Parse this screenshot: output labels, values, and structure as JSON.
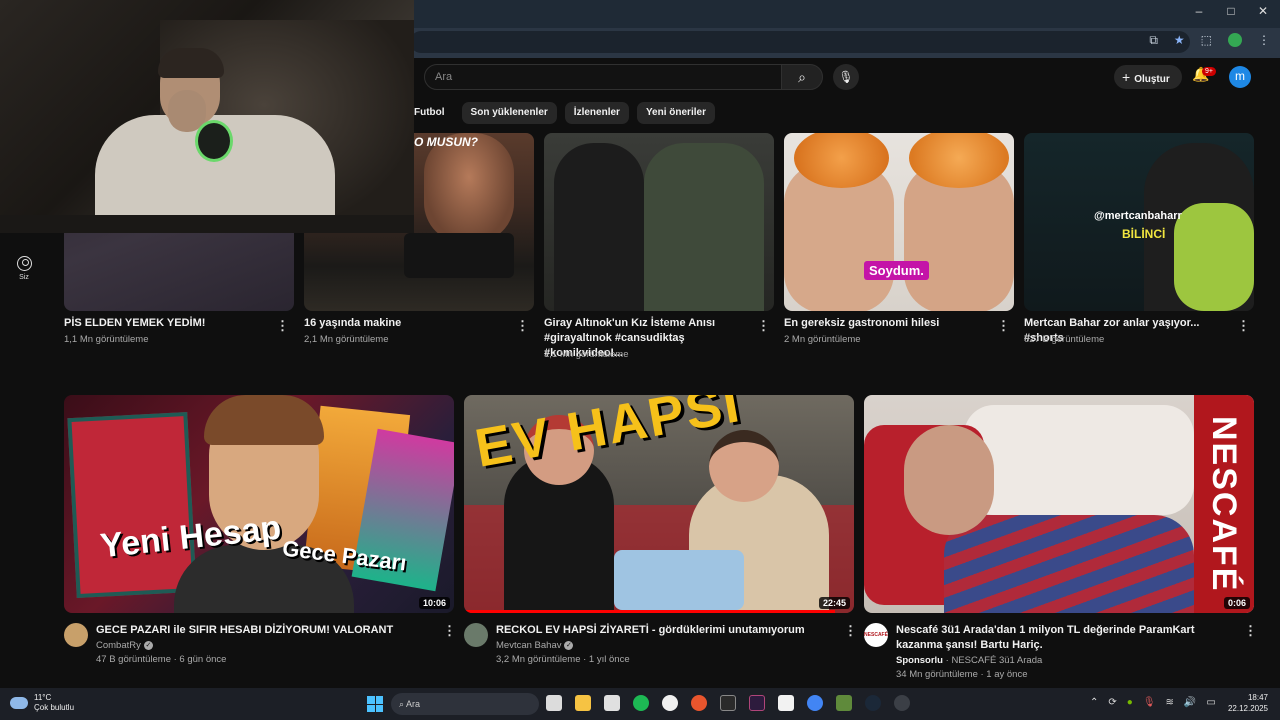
{
  "browser": {
    "window_controls": {
      "minimize": "–",
      "maximize": "□",
      "close": "✕"
    },
    "toolbar_icons": [
      "install-icon",
      "star-icon",
      "extensions-icon",
      "profile-icon",
      "menu-icon"
    ]
  },
  "header": {
    "search_placeholder": "Ara",
    "create_label": "Oluştur",
    "notification_badge": "9+",
    "avatar_letter": "m"
  },
  "chips": [
    "Futbol",
    "Son yüklenenler",
    "İzlenenler",
    "Yeni öneriler"
  ],
  "sidebar": {
    "you_label": "Siz"
  },
  "top_row": [
    {
      "title": "PİS ELDEN YEMEK YEDİM!",
      "views": "1,1 Mn görüntüleme"
    },
    {
      "title": "16 yaşında makine",
      "views": "2,1 Mn görüntüleme",
      "thumb_text": "O MUSUN?"
    },
    {
      "title": "Giray Altınok'un Kız İsteme Anısı #girayaltınok #cansudiktaş #komikvideoI...",
      "views": "1,1 Mn görüntüleme"
    },
    {
      "title": "En gereksiz gastronomi hilesi",
      "views": "2 Mn görüntüleme",
      "thumb_text": "Soydum."
    },
    {
      "title": "Mertcan Bahar zor anlar yaşıyor... #shorts",
      "views": "627 B görüntüleme",
      "thumb_text": "@mertcanbaharr",
      "thumb_text2": "BİLİNCİ"
    }
  ],
  "bottom_row": [
    {
      "title": "GECE PAZARI ile SIFIR HESABI DİZİYORUM! VALORANT",
      "channel": "CombatRy",
      "meta": "47 B görüntüleme · 6 gün önce",
      "duration": "10:06",
      "thumb_text1": "Yeni Hesap",
      "thumb_text2": "Gece Pazarı"
    },
    {
      "title": "RECKOL EV HAPSİ ZİYARETİ - gördüklerimi unutamıyorum",
      "channel": "Mevtcan Bahav",
      "meta": "3,2 Mn görüntüleme · 1 yıl önce",
      "duration": "22:45",
      "thumb_text": "EV HAPSİ"
    },
    {
      "title": "Nescafé 3ü1 Arada'dan 1 milyon TL değerinde ParamKart kazanma şansı! Bartu Hariç.",
      "sponsor_label": "Sponsorlu",
      "channel": "NESCAFÉ 3ü1 Arada",
      "meta": "34 Mn görüntüleme · 1 ay önce",
      "duration": "0:06",
      "thumb_text": "NESCAFÉ",
      "avatar_text": "NESCAFÉ"
    }
  ],
  "taskbar": {
    "temp": "11°C",
    "weather": "Çok bulutlu",
    "search_placeholder": "Ara",
    "time": "18:47",
    "date": "22.12.2025"
  },
  "colors": {
    "accent": "#ff0000",
    "avatar": "#1e88e5",
    "badge": "#cc0000"
  }
}
